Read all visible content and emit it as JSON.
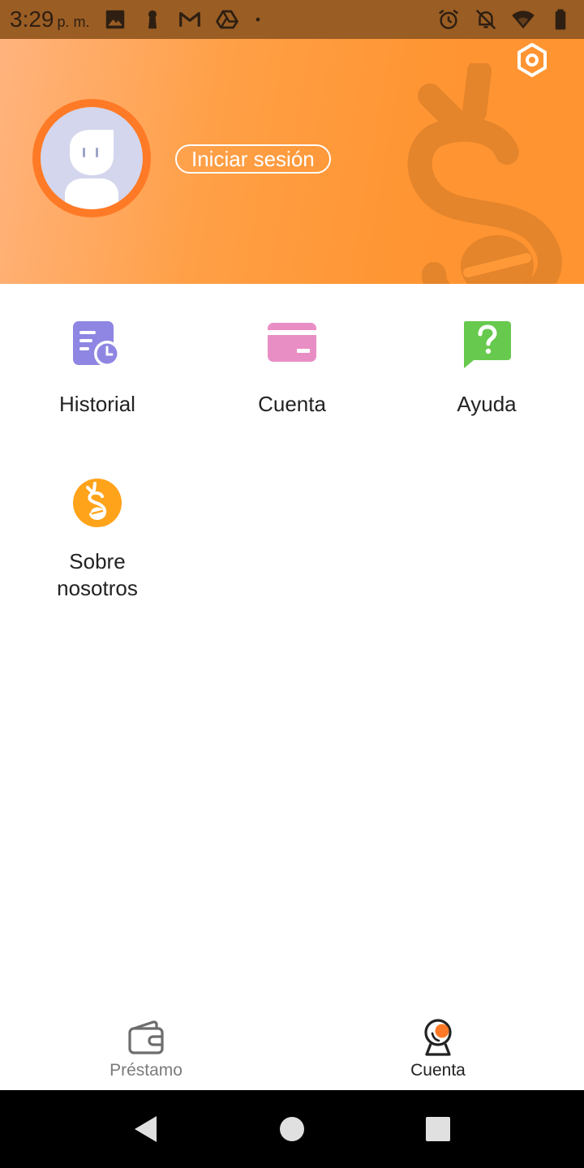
{
  "status_bar": {
    "time": "3:29",
    "ampm": "p. m.",
    "left_icons": [
      "image-icon",
      "keyhole-icon",
      "gmail-icon",
      "drive-icon",
      "dot-icon"
    ],
    "right_icons": [
      "alarm-icon",
      "notifications-off-icon",
      "wifi-icon",
      "battery-icon"
    ]
  },
  "header": {
    "login_label": "Iniciar sesión",
    "settings_icon": "settings-hex-icon",
    "avatar_icon": "default-avatar-icon",
    "colors": {
      "gradient_start": "#ffb37d",
      "gradient_end": "#ff9430",
      "avatar_ring": "#ff7a26"
    }
  },
  "menu": {
    "items": [
      {
        "label": "Historial",
        "icon": "history-icon",
        "color": "#8e86e2"
      },
      {
        "label": "Cuenta",
        "icon": "card-icon",
        "color": "#e98ec4"
      },
      {
        "label": "Ayuda",
        "icon": "help-icon",
        "color": "#67c94d"
      },
      {
        "label": "Sobre nosotros",
        "icon": "about-coin-icon",
        "color": "#ffa31a"
      }
    ]
  },
  "bottom_nav": {
    "items": [
      {
        "label": "Préstamo",
        "icon": "wallet-icon",
        "active": false
      },
      {
        "label": "Cuenta",
        "icon": "account-icon",
        "active": true
      }
    ]
  },
  "system_nav": {
    "buttons": [
      "back-icon",
      "home-icon",
      "recents-icon"
    ]
  }
}
